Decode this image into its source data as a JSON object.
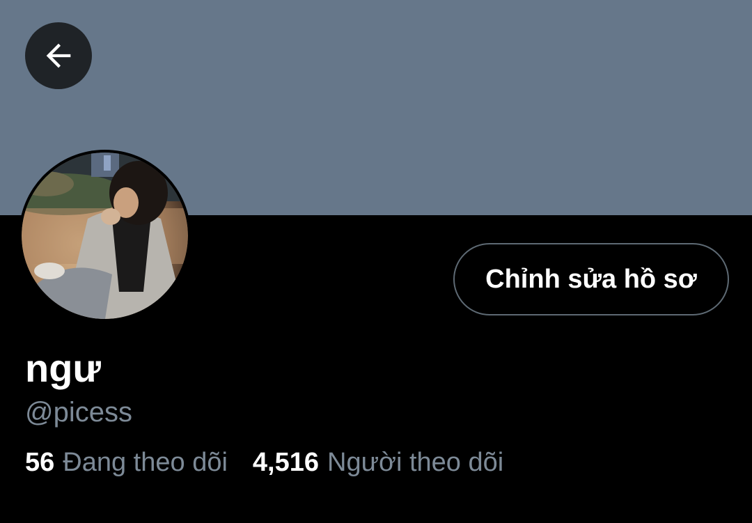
{
  "header": {
    "banner_color": "#66778a",
    "back_icon": "arrow-left-icon"
  },
  "profile": {
    "display_name": "ngư",
    "handle": "@picess",
    "edit_button_label": "Chỉnh sửa hồ sơ",
    "avatar_icon": "profile-photo"
  },
  "stats": {
    "following_count": "56",
    "following_label": "Đang theo dõi",
    "followers_count": "4,516",
    "followers_label": "Người theo dõi"
  },
  "colors": {
    "background": "#000000",
    "text_primary": "#ffffff",
    "text_secondary": "#7d8a97",
    "button_border": "#5e6a74"
  }
}
